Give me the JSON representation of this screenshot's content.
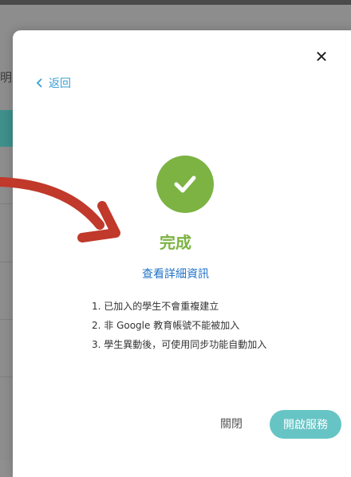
{
  "background": {
    "partial_text": "明丑"
  },
  "modal": {
    "back_label": "返回",
    "close_symbol": "✕",
    "status_title": "完成",
    "detail_link": "查看詳細資訊",
    "notes": [
      "1. 已加入的學生不會重複建立",
      "2. 非 Google 教育帳號不能被加入",
      "3. 學生異動後，可使用同步功能自動加入"
    ],
    "footer": {
      "close_label": "關閉",
      "enable_label": "開啟服務"
    }
  },
  "colors": {
    "success_green": "#7cb342",
    "link_blue": "#1f73c8",
    "back_blue": "#3a9fd6",
    "primary_teal": "#67c4c5",
    "annotation_red": "#c0392b"
  },
  "icons": {
    "success": "check-icon",
    "close": "close-icon",
    "back": "chevron-left-icon",
    "annotation": "curved-arrow-icon"
  }
}
